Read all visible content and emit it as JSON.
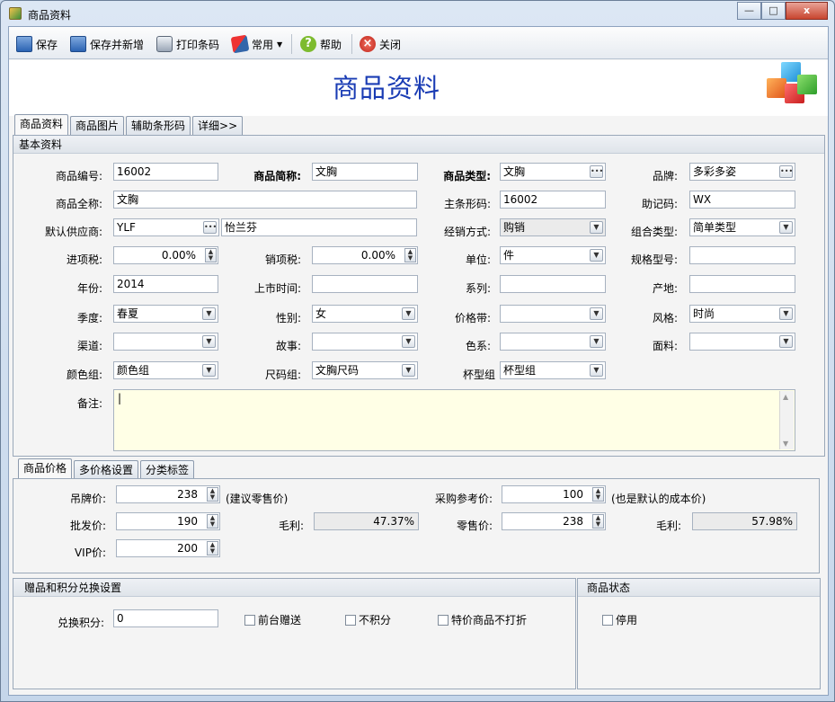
{
  "window": {
    "title": "商品资料",
    "min": "—",
    "max": "□",
    "close": "x"
  },
  "toolbar": {
    "save": "保存",
    "save_new": "保存并新增",
    "print_barcode": "打印条码",
    "common": "常用",
    "help": "帮助",
    "close": "关闭",
    "help_glyph": "?",
    "close_glyph": "×"
  },
  "page_title": "商品资料",
  "main_tabs": [
    "商品资料",
    "商品图片",
    "辅助条形码",
    "详细>>"
  ],
  "basic_section": "基本资料",
  "fields": {
    "code": {
      "label": "商品编号:",
      "value": "16002"
    },
    "short_name": {
      "label": "商品简称:",
      "value": "文胸"
    },
    "type": {
      "label": "商品类型:",
      "value": "文胸"
    },
    "brand": {
      "label": "品牌:",
      "value": "多彩多姿"
    },
    "full_name": {
      "label": "商品全称:",
      "value": "文胸"
    },
    "barcode": {
      "label": "主条形码:",
      "value": "16002"
    },
    "mnemonic": {
      "label": "助记码:",
      "value": "WX"
    },
    "supplier": {
      "label": "默认供应商:",
      "code": "YLF",
      "name": "怡兰芬"
    },
    "sale_mode": {
      "label": "经销方式:",
      "value": "购销"
    },
    "combo_type": {
      "label": "组合类型:",
      "value": "简单类型"
    },
    "input_tax": {
      "label": "进项税:",
      "value": "0.00%"
    },
    "output_tax": {
      "label": "销项税:",
      "value": "0.00%"
    },
    "unit": {
      "label": "单位:",
      "value": "件"
    },
    "spec": {
      "label": "规格型号:",
      "value": ""
    },
    "year": {
      "label": "年份:",
      "value": "2014"
    },
    "launch": {
      "label": "上市时间:",
      "value": ""
    },
    "series": {
      "label": "系列:",
      "value": ""
    },
    "origin": {
      "label": "产地:",
      "value": ""
    },
    "season": {
      "label": "季度:",
      "value": "春夏"
    },
    "gender": {
      "label": "性别:",
      "value": "女"
    },
    "price_band": {
      "label": "价格带:",
      "value": ""
    },
    "style": {
      "label": "风格:",
      "value": "时尚"
    },
    "channel": {
      "label": "渠道:",
      "value": ""
    },
    "story": {
      "label": "故事:",
      "value": ""
    },
    "color_series": {
      "label": "色系:",
      "value": ""
    },
    "fabric": {
      "label": "面料:",
      "value": ""
    },
    "color_group": {
      "label": "颜色组:",
      "value": "颜色组"
    },
    "size_group": {
      "label": "尺码组:",
      "value": "文胸尺码"
    },
    "cup_group": {
      "label": "杯型组",
      "value": "杯型组"
    },
    "remark": {
      "label": "备注:",
      "value": "|"
    }
  },
  "price_tabs": [
    "商品价格",
    "多价格设置",
    "分类标签"
  ],
  "prices": {
    "tag": {
      "label": "吊牌价:",
      "value": "238",
      "note": "(建议零售价)"
    },
    "purchase": {
      "label": "采购参考价:",
      "value": "100",
      "note": "(也是默认的成本价)"
    },
    "wholesale": {
      "label": "批发价:",
      "value": "190"
    },
    "margin1": {
      "label": "毛利:",
      "value": "47.37%"
    },
    "retail": {
      "label": "零售价:",
      "value": "238"
    },
    "margin2": {
      "label": "毛利:",
      "value": "57.98%"
    },
    "vip": {
      "label": "VIP价:",
      "value": "200"
    }
  },
  "points": {
    "section": "赠品和积分兑换设置",
    "label": "兑换积分:",
    "value": "0",
    "gift": "前台赠送",
    "no_points": "不积分",
    "special_no_discount": "特价商品不打折"
  },
  "status": {
    "section": "商品状态",
    "disabled": "停用"
  }
}
